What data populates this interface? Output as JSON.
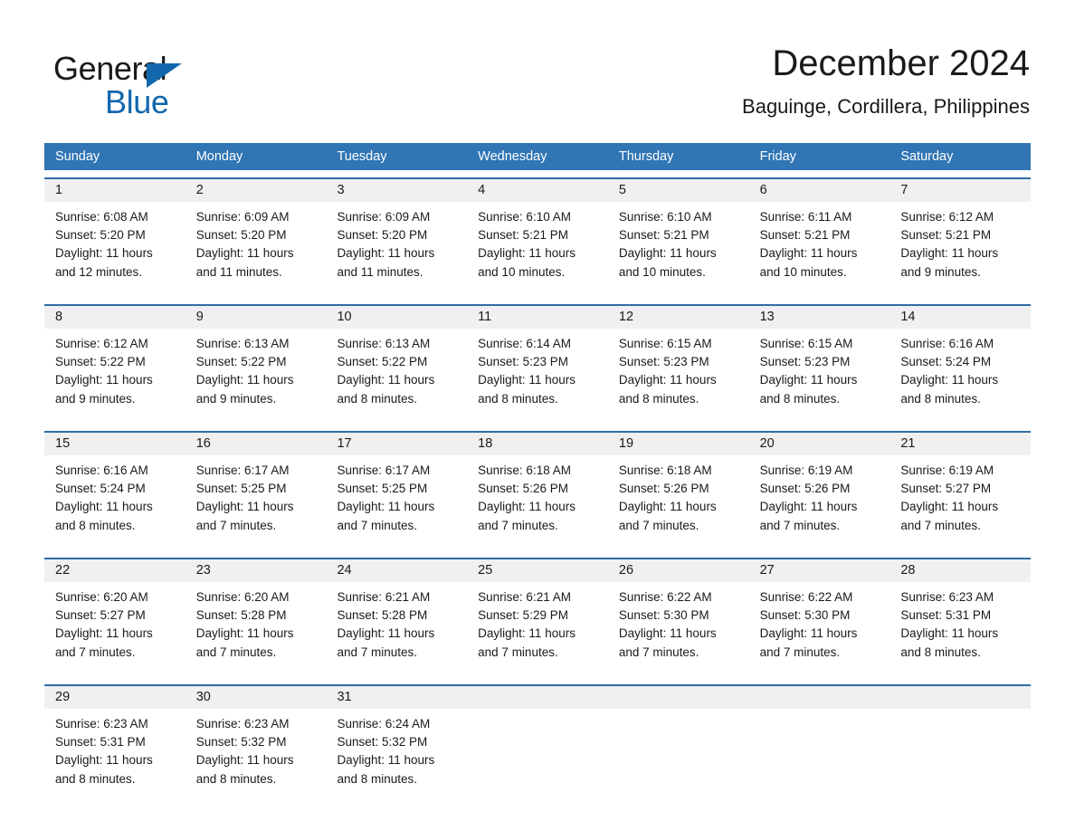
{
  "brand": {
    "name_part1": "General",
    "name_part2": "Blue",
    "accent_color": "#1267ad"
  },
  "header": {
    "title": "December 2024",
    "subtitle": "Baguinge, Cordillera, Philippines"
  },
  "theme": {
    "header_blue": "#3075b4",
    "row_rule_blue": "#2e6da4",
    "daynum_band": "#f0f0f0"
  },
  "weekdays": [
    "Sunday",
    "Monday",
    "Tuesday",
    "Wednesday",
    "Thursday",
    "Friday",
    "Saturday"
  ],
  "weeks": [
    [
      {
        "day": "1",
        "sunrise": "Sunrise: 6:08 AM",
        "sunset": "Sunset: 5:20 PM",
        "daylight_line1": "Daylight: 11 hours",
        "daylight_line2": "and 12 minutes."
      },
      {
        "day": "2",
        "sunrise": "Sunrise: 6:09 AM",
        "sunset": "Sunset: 5:20 PM",
        "daylight_line1": "Daylight: 11 hours",
        "daylight_line2": "and 11 minutes."
      },
      {
        "day": "3",
        "sunrise": "Sunrise: 6:09 AM",
        "sunset": "Sunset: 5:20 PM",
        "daylight_line1": "Daylight: 11 hours",
        "daylight_line2": "and 11 minutes."
      },
      {
        "day": "4",
        "sunrise": "Sunrise: 6:10 AM",
        "sunset": "Sunset: 5:21 PM",
        "daylight_line1": "Daylight: 11 hours",
        "daylight_line2": "and 10 minutes."
      },
      {
        "day": "5",
        "sunrise": "Sunrise: 6:10 AM",
        "sunset": "Sunset: 5:21 PM",
        "daylight_line1": "Daylight: 11 hours",
        "daylight_line2": "and 10 minutes."
      },
      {
        "day": "6",
        "sunrise": "Sunrise: 6:11 AM",
        "sunset": "Sunset: 5:21 PM",
        "daylight_line1": "Daylight: 11 hours",
        "daylight_line2": "and 10 minutes."
      },
      {
        "day": "7",
        "sunrise": "Sunrise: 6:12 AM",
        "sunset": "Sunset: 5:21 PM",
        "daylight_line1": "Daylight: 11 hours",
        "daylight_line2": "and 9 minutes."
      }
    ],
    [
      {
        "day": "8",
        "sunrise": "Sunrise: 6:12 AM",
        "sunset": "Sunset: 5:22 PM",
        "daylight_line1": "Daylight: 11 hours",
        "daylight_line2": "and 9 minutes."
      },
      {
        "day": "9",
        "sunrise": "Sunrise: 6:13 AM",
        "sunset": "Sunset: 5:22 PM",
        "daylight_line1": "Daylight: 11 hours",
        "daylight_line2": "and 9 minutes."
      },
      {
        "day": "10",
        "sunrise": "Sunrise: 6:13 AM",
        "sunset": "Sunset: 5:22 PM",
        "daylight_line1": "Daylight: 11 hours",
        "daylight_line2": "and 8 minutes."
      },
      {
        "day": "11",
        "sunrise": "Sunrise: 6:14 AM",
        "sunset": "Sunset: 5:23 PM",
        "daylight_line1": "Daylight: 11 hours",
        "daylight_line2": "and 8 minutes."
      },
      {
        "day": "12",
        "sunrise": "Sunrise: 6:15 AM",
        "sunset": "Sunset: 5:23 PM",
        "daylight_line1": "Daylight: 11 hours",
        "daylight_line2": "and 8 minutes."
      },
      {
        "day": "13",
        "sunrise": "Sunrise: 6:15 AM",
        "sunset": "Sunset: 5:23 PM",
        "daylight_line1": "Daylight: 11 hours",
        "daylight_line2": "and 8 minutes."
      },
      {
        "day": "14",
        "sunrise": "Sunrise: 6:16 AM",
        "sunset": "Sunset: 5:24 PM",
        "daylight_line1": "Daylight: 11 hours",
        "daylight_line2": "and 8 minutes."
      }
    ],
    [
      {
        "day": "15",
        "sunrise": "Sunrise: 6:16 AM",
        "sunset": "Sunset: 5:24 PM",
        "daylight_line1": "Daylight: 11 hours",
        "daylight_line2": "and 8 minutes."
      },
      {
        "day": "16",
        "sunrise": "Sunrise: 6:17 AM",
        "sunset": "Sunset: 5:25 PM",
        "daylight_line1": "Daylight: 11 hours",
        "daylight_line2": "and 7 minutes."
      },
      {
        "day": "17",
        "sunrise": "Sunrise: 6:17 AM",
        "sunset": "Sunset: 5:25 PM",
        "daylight_line1": "Daylight: 11 hours",
        "daylight_line2": "and 7 minutes."
      },
      {
        "day": "18",
        "sunrise": "Sunrise: 6:18 AM",
        "sunset": "Sunset: 5:26 PM",
        "daylight_line1": "Daylight: 11 hours",
        "daylight_line2": "and 7 minutes."
      },
      {
        "day": "19",
        "sunrise": "Sunrise: 6:18 AM",
        "sunset": "Sunset: 5:26 PM",
        "daylight_line1": "Daylight: 11 hours",
        "daylight_line2": "and 7 minutes."
      },
      {
        "day": "20",
        "sunrise": "Sunrise: 6:19 AM",
        "sunset": "Sunset: 5:26 PM",
        "daylight_line1": "Daylight: 11 hours",
        "daylight_line2": "and 7 minutes."
      },
      {
        "day": "21",
        "sunrise": "Sunrise: 6:19 AM",
        "sunset": "Sunset: 5:27 PM",
        "daylight_line1": "Daylight: 11 hours",
        "daylight_line2": "and 7 minutes."
      }
    ],
    [
      {
        "day": "22",
        "sunrise": "Sunrise: 6:20 AM",
        "sunset": "Sunset: 5:27 PM",
        "daylight_line1": "Daylight: 11 hours",
        "daylight_line2": "and 7 minutes."
      },
      {
        "day": "23",
        "sunrise": "Sunrise: 6:20 AM",
        "sunset": "Sunset: 5:28 PM",
        "daylight_line1": "Daylight: 11 hours",
        "daylight_line2": "and 7 minutes."
      },
      {
        "day": "24",
        "sunrise": "Sunrise: 6:21 AM",
        "sunset": "Sunset: 5:28 PM",
        "daylight_line1": "Daylight: 11 hours",
        "daylight_line2": "and 7 minutes."
      },
      {
        "day": "25",
        "sunrise": "Sunrise: 6:21 AM",
        "sunset": "Sunset: 5:29 PM",
        "daylight_line1": "Daylight: 11 hours",
        "daylight_line2": "and 7 minutes."
      },
      {
        "day": "26",
        "sunrise": "Sunrise: 6:22 AM",
        "sunset": "Sunset: 5:30 PM",
        "daylight_line1": "Daylight: 11 hours",
        "daylight_line2": "and 7 minutes."
      },
      {
        "day": "27",
        "sunrise": "Sunrise: 6:22 AM",
        "sunset": "Sunset: 5:30 PM",
        "daylight_line1": "Daylight: 11 hours",
        "daylight_line2": "and 7 minutes."
      },
      {
        "day": "28",
        "sunrise": "Sunrise: 6:23 AM",
        "sunset": "Sunset: 5:31 PM",
        "daylight_line1": "Daylight: 11 hours",
        "daylight_line2": "and 8 minutes."
      }
    ],
    [
      {
        "day": "29",
        "sunrise": "Sunrise: 6:23 AM",
        "sunset": "Sunset: 5:31 PM",
        "daylight_line1": "Daylight: 11 hours",
        "daylight_line2": "and 8 minutes."
      },
      {
        "day": "30",
        "sunrise": "Sunrise: 6:23 AM",
        "sunset": "Sunset: 5:32 PM",
        "daylight_line1": "Daylight: 11 hours",
        "daylight_line2": "and 8 minutes."
      },
      {
        "day": "31",
        "sunrise": "Sunrise: 6:24 AM",
        "sunset": "Sunset: 5:32 PM",
        "daylight_line1": "Daylight: 11 hours",
        "daylight_line2": "and 8 minutes."
      },
      {
        "day": "",
        "sunrise": "",
        "sunset": "",
        "daylight_line1": "",
        "daylight_line2": ""
      },
      {
        "day": "",
        "sunrise": "",
        "sunset": "",
        "daylight_line1": "",
        "daylight_line2": ""
      },
      {
        "day": "",
        "sunrise": "",
        "sunset": "",
        "daylight_line1": "",
        "daylight_line2": ""
      },
      {
        "day": "",
        "sunrise": "",
        "sunset": "",
        "daylight_line1": "",
        "daylight_line2": ""
      }
    ]
  ]
}
